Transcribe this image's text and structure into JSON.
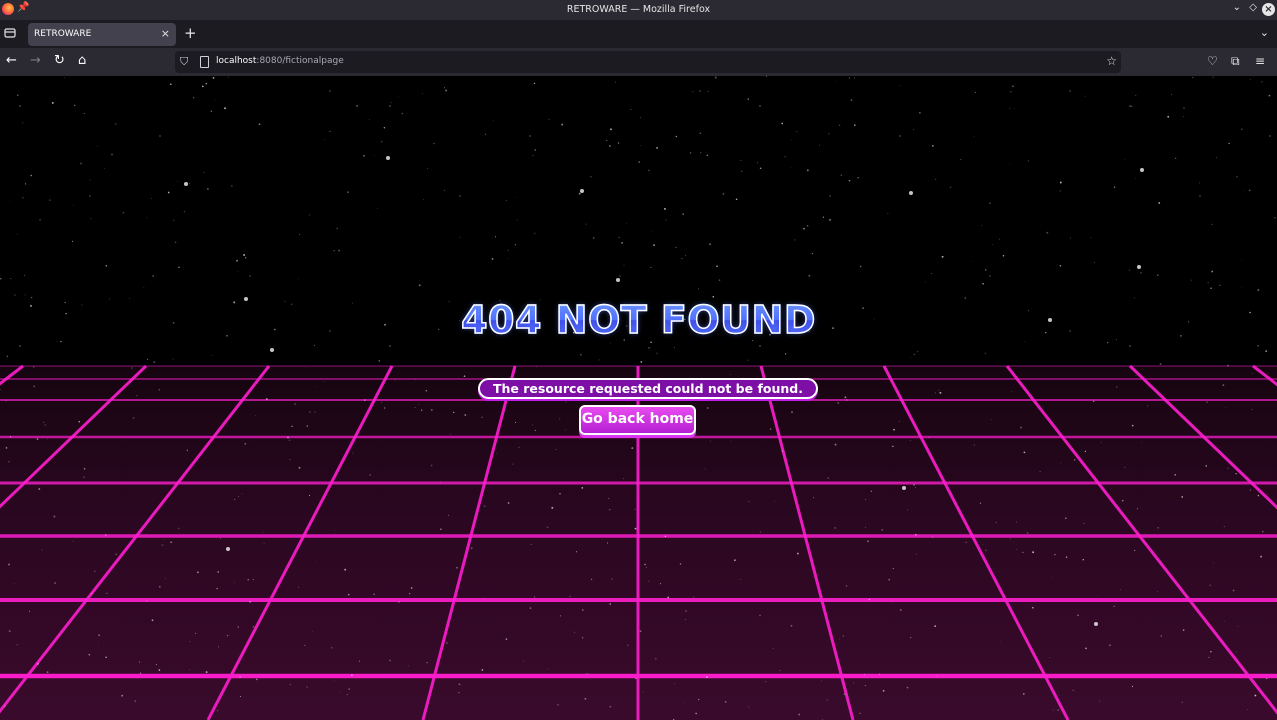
{
  "window": {
    "title": "RETROWARE — Mozilla Firefox"
  },
  "tabs": [
    {
      "label": "RETROWARE",
      "active": true
    }
  ],
  "address_bar": {
    "host": "localhost",
    "path": ":8080/fictionalpage"
  },
  "page": {
    "headline": "404 NOT FOUND",
    "message": "The resource requested could not be found.",
    "home_button": "Go back home"
  },
  "colors": {
    "grid_line": "#ff1ecf",
    "floor": "#2a0720",
    "headline": "#3b4cff",
    "message_bg": "#7d0fa6",
    "button_bg": "#c42ee0"
  }
}
